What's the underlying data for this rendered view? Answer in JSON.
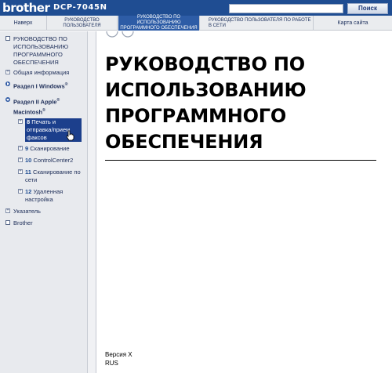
{
  "header": {
    "logo": "brother",
    "model": "DCP-7045N",
    "search_placeholder": "",
    "search_button": "Поиск"
  },
  "nav": {
    "back": "Наверх",
    "user_guide": "Руководство пользователя",
    "software_guide": "Руководство по использованию программного обеспечения",
    "network_guide": "Руководство пользователя по работе в сети",
    "site_map": "Карта сайта"
  },
  "sidebar": {
    "software_guide": "РУКОВОДСТВО ПО ИСПОЛЬЗОВАНИЮ ПРОГРАММНОГО ОБЕСПЕЧЕНИЯ",
    "general_info": "Общая информация",
    "section1": "Раздел I Windows",
    "section1_reg": "®",
    "section2_a": "Раздел II Apple",
    "section2_reg": "®",
    "section2_b": "Macintosh",
    "section2_b_reg": "®",
    "ch8_num": "8",
    "ch8_label": "Печать и отправка/прием факсов",
    "ch9_num": "9",
    "ch9_label": "Сканирование",
    "ch10_num": "10",
    "ch10_label": "ControlCenter2",
    "ch11_num": "11",
    "ch11_label": "Сканирование по сети",
    "ch12_num": "12",
    "ch12_label": "Удаленная настройка",
    "index": "Указатель",
    "brother": "Brother"
  },
  "content": {
    "title": "РУКОВОДСТВО ПО ИСПОЛЬЗОВАНИЮ ПРОГРАММНОГО ОБЕСПЕЧЕНИЯ",
    "version": "Версия X",
    "language": "RUS"
  },
  "colors": {
    "header_blue": "#1f4d92",
    "active_tab": "#2d5ca6",
    "selected_bg": "#1c3f8c",
    "sidebar_bg": "#e8eaee"
  }
}
